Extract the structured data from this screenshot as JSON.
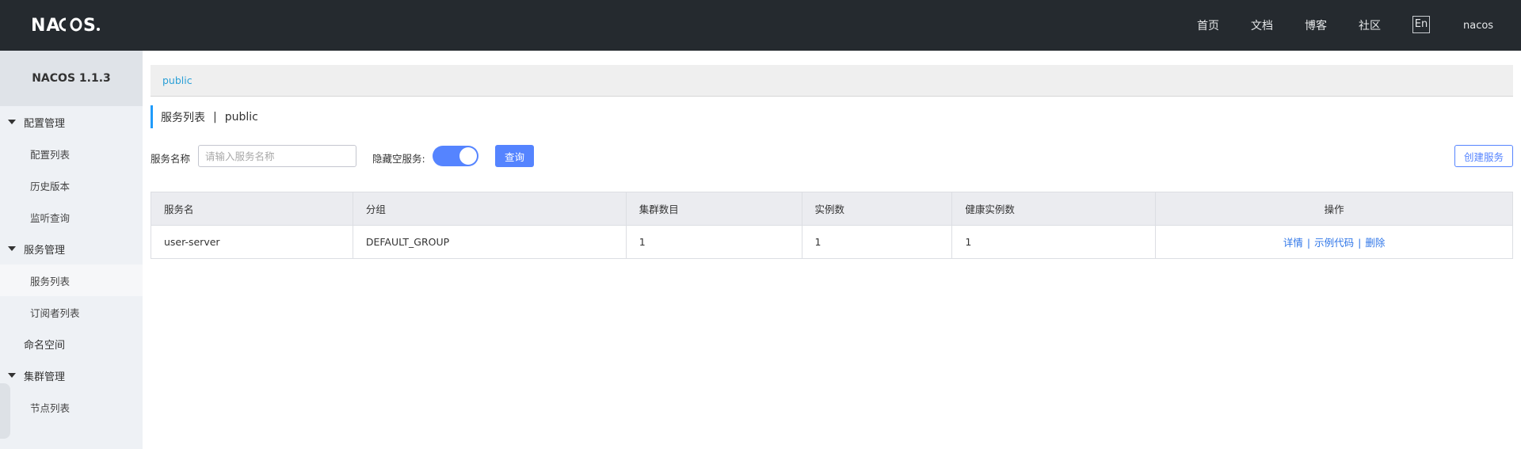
{
  "header": {
    "logo_text": "NACOS.",
    "nav": {
      "home": "首页",
      "docs": "文档",
      "blog": "博客",
      "community": "社区"
    },
    "lang_button": "En",
    "user": "nacos"
  },
  "sidebar": {
    "version": "NACOS 1.1.3",
    "groups": {
      "config": {
        "label": "配置管理",
        "items": [
          "配置列表",
          "历史版本",
          "监听查询"
        ]
      },
      "service": {
        "label": "服务管理",
        "items": [
          "服务列表",
          "订阅者列表"
        ]
      },
      "namespace": "命名空间",
      "cluster": {
        "label": "集群管理",
        "items": [
          "节点列表"
        ]
      }
    },
    "active_item": "服务列表"
  },
  "breadcrumb": {
    "namespace": "public"
  },
  "page": {
    "title": "服务列表",
    "separator": "|",
    "namespace": "public"
  },
  "filters": {
    "service_name_label": "服务名称",
    "service_name_placeholder": "请输入服务名称",
    "service_name_value": "",
    "hide_empty_label": "隐藏空服务:",
    "hide_empty_enabled": true,
    "query_button": "查询",
    "create_button": "创建服务"
  },
  "table": {
    "columns": [
      "服务名",
      "分组",
      "集群数目",
      "实例数",
      "健康实例数",
      "操作"
    ],
    "rows": [
      {
        "service_name": "user-server",
        "group": "DEFAULT_GROUP",
        "cluster_count": "1",
        "instance_count": "1",
        "healthy_instance_count": "1",
        "actions": [
          "详情",
          "示例代码",
          "删除"
        ]
      }
    ]
  },
  "colors": {
    "header_bg": "#252a2f",
    "sidebar_bg": "#eef1f5",
    "primary": "#5584ff",
    "breadcrumb_link": "#2a9fd6",
    "action_link": "#2f76e8"
  }
}
